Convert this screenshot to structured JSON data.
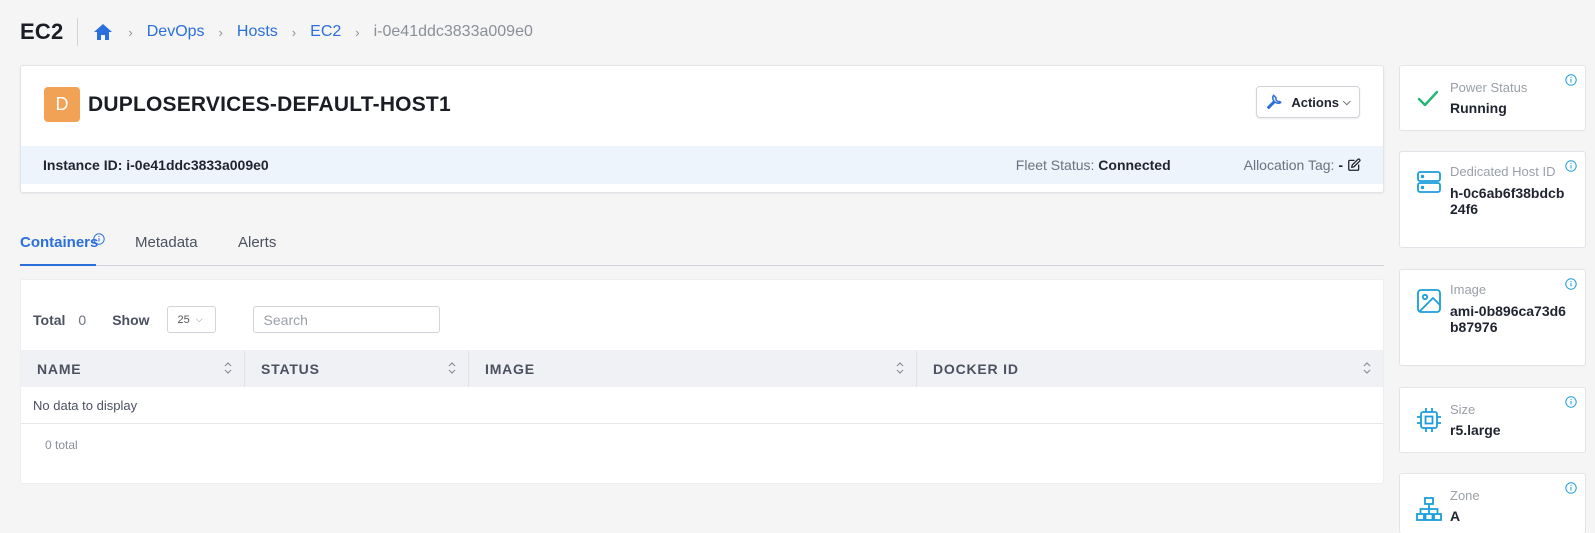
{
  "header": {
    "title": "EC2",
    "breadcrumbs": [
      "DevOps",
      "Hosts",
      "EC2"
    ],
    "breadcrumb_current": "i-0e41ddc3833a009e0"
  },
  "host": {
    "avatar_letter": "D",
    "avatar_color": "#f2a254",
    "name": "DUPLOSERVICES-DEFAULT-HOST1",
    "actions_label": "Actions",
    "instance_id_text": "Instance ID: i-0e41ddc3833a009e0",
    "fleet_label": "Fleet Status:",
    "fleet_value": "Connected",
    "alloc_label": "Allocation Tag:",
    "alloc_value": "-"
  },
  "tabs": [
    {
      "label": "Containers",
      "active": true
    },
    {
      "label": "Metadata",
      "active": false
    },
    {
      "label": "Alerts",
      "active": false
    }
  ],
  "table": {
    "total_label": "Total",
    "total_value": "0",
    "show_label": "Show",
    "page_size": "25",
    "search_placeholder": "Search",
    "columns": [
      "NAME",
      "STATUS",
      "IMAGE",
      "DOCKER ID"
    ],
    "empty_text": "No data to display",
    "footer_total": "0 total"
  },
  "side": {
    "power": {
      "label": "Power Status",
      "value": "Running",
      "icon": "check-icon"
    },
    "dedicated_host": {
      "label": "Dedicated Host ID",
      "value": "h-0c6ab6f38bdcb24f6",
      "icon": "server-icon"
    },
    "image": {
      "label": "Image",
      "value": "ami-0b896ca73d6b87976",
      "icon": "image-icon"
    },
    "size": {
      "label": "Size",
      "value": "r5.large",
      "icon": "cpu-icon"
    },
    "zone": {
      "label": "Zone",
      "value": "A",
      "icon": "network-icon"
    }
  },
  "colors": {
    "accent": "#2a6fdb",
    "success": "#22b573",
    "side_icon": "#1a9fd9"
  }
}
